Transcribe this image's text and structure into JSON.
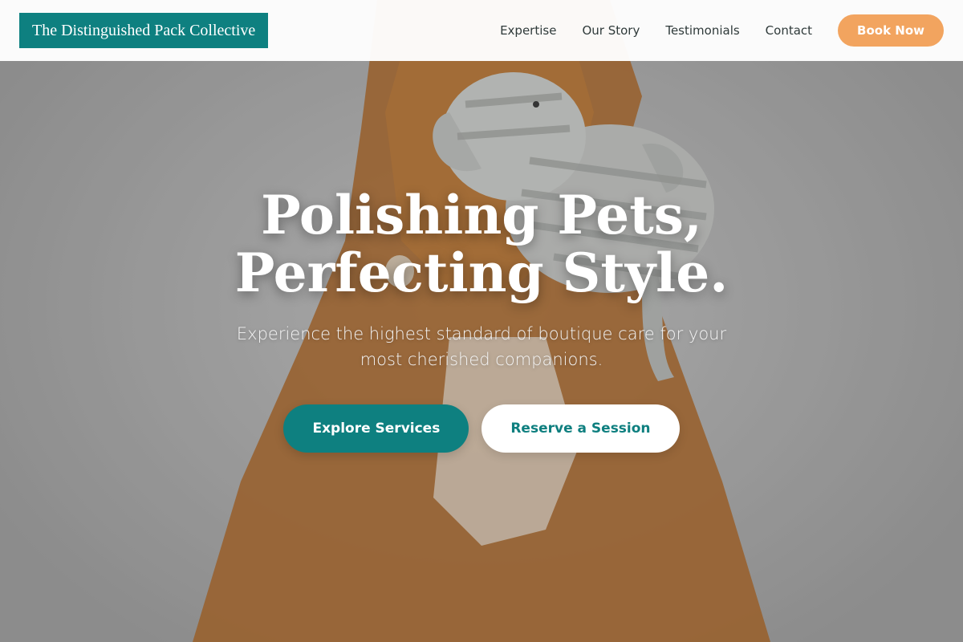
{
  "brand": {
    "name": "The Distinguished Pack Collective"
  },
  "nav": {
    "links": [
      "Expertise",
      "Our Story",
      "Testimonials",
      "Contact"
    ],
    "cta": "Book Now"
  },
  "hero": {
    "headline": "Polishing Pets, Perfecting Style.",
    "subheadline": "Experience the highest standard of boutique care for your most cherished companions.",
    "primary_button": "Explore Services",
    "secondary_button": "Reserve a Session",
    "image": "golden dog holding striped plush elephant toy"
  },
  "colors": {
    "brand_teal": "#0e8080",
    "cta_orange": "#f2a45f",
    "white": "#ffffff"
  }
}
